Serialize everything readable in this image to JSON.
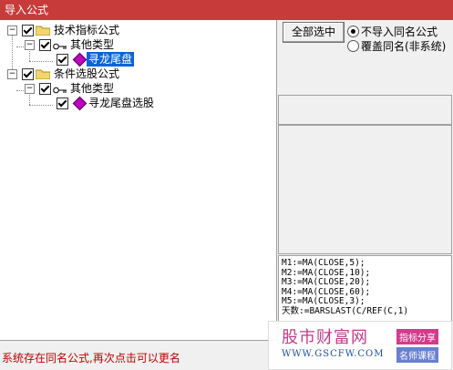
{
  "window": {
    "title": "导入公式"
  },
  "tree": {
    "nodes": [
      {
        "label": "技术指标公式"
      },
      {
        "label": "其他类型"
      },
      {
        "label": "寻龙尾盘"
      },
      {
        "label": "条件选股公式"
      },
      {
        "label": "其他类型"
      },
      {
        "label": "寻龙尾盘选股"
      }
    ]
  },
  "options": {
    "select_all_label": "全部选中",
    "radio_no_import": "不导入同名公式",
    "radio_overwrite": "覆盖同名(非系统)"
  },
  "code_lines": [
    "M1:=MA(CLOSE,5);",
    "M2:=MA(CLOSE,10);",
    "M3:=MA(CLOSE,20);",
    "M4:=MA(CLOSE,60);",
    "M5:=MA(CLOSE,3);",
    "天数:=BARSLAST(C/REF(C,1)"
  ],
  "status": {
    "text": "系统存在同名公式,再次点击可以更名"
  },
  "watermark": {
    "title": "股市财富网",
    "url": "WWW.GSCFW.COM",
    "tag1": "指标分享",
    "tag2": "名师课程"
  }
}
